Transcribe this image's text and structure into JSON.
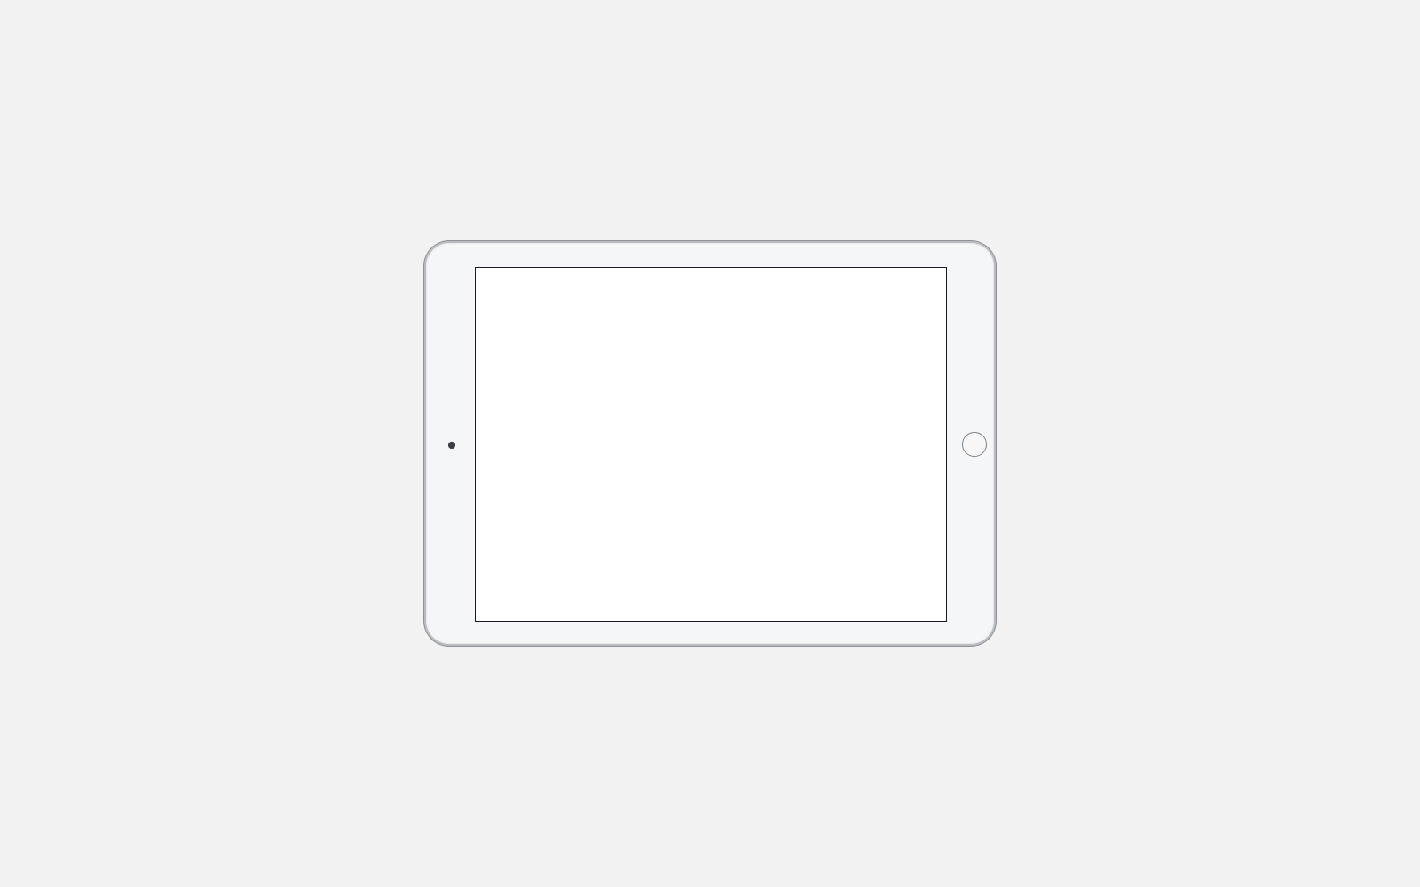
{
  "page": {
    "background_color": "#f2f2f2"
  },
  "device": {
    "body_color": "#f5f6f8",
    "screen_color": "#ffffff",
    "camera_color": "#3b3f48"
  }
}
